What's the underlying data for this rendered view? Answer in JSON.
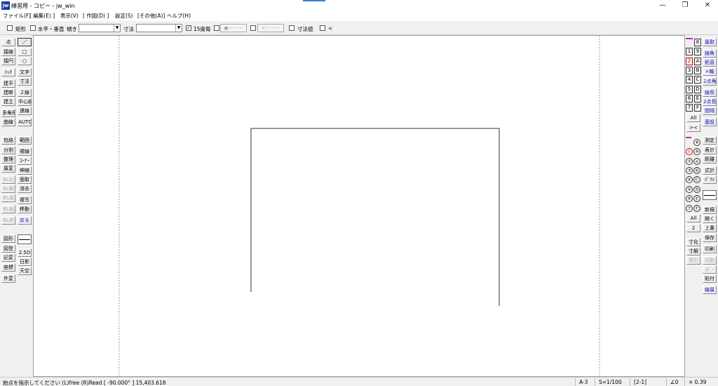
{
  "window": {
    "title": "練習用 - コピー - jw_win",
    "logo_text": "jw",
    "min": "—",
    "max": "❐",
    "close": "✕"
  },
  "menu": [
    "ファイル(F)",
    "[ 編集(E) ]",
    "表示(V)",
    "[ 作図(D) ]",
    "設定(S)",
    "[その他(A)]",
    "ヘルプ(H)"
  ],
  "toolbar": {
    "rect_label": "矩形",
    "hv_label": "水平・垂直",
    "tilt_label": "傾き",
    "dim_label": "寸法",
    "deg15_label": "15度毎",
    "deg15_checked": "✓",
    "dot_btn": "●－－－",
    "arrow_btn": "<－－－",
    "dimval_label": "寸法値",
    "lt_label": "<"
  },
  "left_col1": [
    "点",
    "接線",
    "接円",
    "ﾊｯﾁ",
    "建平",
    "建断",
    "建立",
    "多角形",
    "曲線",
    "包絡",
    "分割",
    "整理",
    "属変",
    "BL化",
    "BL解",
    "BL属",
    "BL編",
    "BL終",
    "図形",
    "図登",
    "記変",
    "座標",
    "外変"
  ],
  "left_col2": [
    "／",
    "□",
    "○",
    "文字",
    "寸法",
    "２線",
    "中心線",
    "連線",
    "AUTO",
    "範囲",
    "複線",
    "ｺｰﾅｰ",
    "伸縮",
    "面取",
    "消去",
    "複写",
    "移動",
    "戻る",
    "2.5D",
    "日影",
    "天空"
  ],
  "layer_group_labels": [
    "8",
    "1",
    "9",
    "2",
    "A",
    "3",
    "B",
    "4",
    "C",
    "5",
    "D",
    "6",
    "E",
    "7",
    "F",
    "All",
    "><"
  ],
  "layer_circ_labels": [
    "⑧",
    "①",
    "⑨",
    "②",
    "Ⓐ",
    "③",
    "Ⓑ",
    "④",
    "Ⓒ",
    "⑤",
    "Ⓓ",
    "⑥",
    "Ⓔ",
    "⑦",
    "Ⓕ",
    "All",
    "2"
  ],
  "right_extra": [
    "寸化",
    "寸解",
    "復旧"
  ],
  "right_col2": [
    "属取",
    "線角",
    "鉛直",
    "×軸",
    "2点角",
    "線長",
    "2点長",
    "間隔",
    "基設",
    "測定",
    "表計",
    "距離",
    "式計",
    "ﾊﾟﾗﾒ",
    "新規",
    "開く",
    "上書",
    "保存",
    "印刷",
    "切取",
    "ｺﾋﾟｰ",
    "貼付",
    "線属"
  ],
  "status": {
    "message": "始点を指示してください (L)free (R)Read [ -90.000° ] 15,403.618",
    "paper": "A-3",
    "scale": "S=1/100",
    "layer": "[2-1]",
    "angle": "∠0",
    "factor": "× 0.39"
  }
}
